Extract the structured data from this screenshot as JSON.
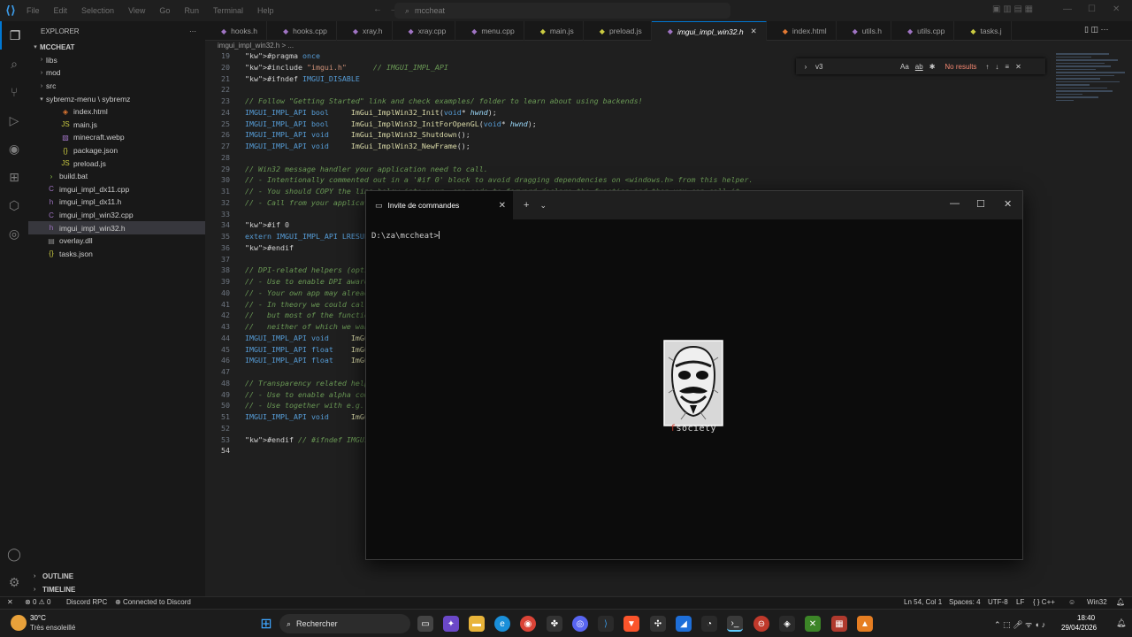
{
  "titlebar": {
    "menu": [
      "File",
      "Edit",
      "Selection",
      "View",
      "Go",
      "Run",
      "Terminal",
      "Help"
    ],
    "command_center": "mccheat"
  },
  "sidebar": {
    "explorer_title": "EXPLORER",
    "root": "MCCHEAT",
    "items": [
      {
        "label": "libs",
        "kind": "folder"
      },
      {
        "label": "mod",
        "kind": "folder"
      },
      {
        "label": "src",
        "kind": "folder"
      },
      {
        "label": "sybremz-menu \\ sybremz",
        "kind": "folder-open"
      },
      {
        "label": "index.html",
        "kind": "html"
      },
      {
        "label": "main.js",
        "kind": "js"
      },
      {
        "label": "minecraft.webp",
        "kind": "img"
      },
      {
        "label": "package.json",
        "kind": "json"
      },
      {
        "label": "preload.js",
        "kind": "js"
      },
      {
        "label": "build.bat",
        "kind": "bat"
      },
      {
        "label": "imgui_impl_dx11.cpp",
        "kind": "cpp"
      },
      {
        "label": "imgui_impl_dx11.h",
        "kind": "h"
      },
      {
        "label": "imgui_impl_win32.cpp",
        "kind": "cpp"
      },
      {
        "label": "imgui_impl_win32.h",
        "kind": "h"
      },
      {
        "label": "overlay.dll",
        "kind": "dll"
      },
      {
        "label": "tasks.json",
        "kind": "json"
      }
    ],
    "outline": "OUTLINE",
    "timeline": "TIMELINE"
  },
  "tabs": [
    {
      "label": "hooks.h"
    },
    {
      "label": "hooks.cpp"
    },
    {
      "label": "xray.h"
    },
    {
      "label": "xray.cpp"
    },
    {
      "label": "menu.cpp"
    },
    {
      "label": "main.js"
    },
    {
      "label": "preload.js"
    },
    {
      "label": "imgui_impl_win32.h"
    },
    {
      "label": "index.html"
    },
    {
      "label": "utils.h"
    },
    {
      "label": "utils.cpp"
    },
    {
      "label": "tasks.j"
    }
  ],
  "breadcrumb": "imgui_impl_win32.h > ...",
  "find": {
    "value": "v3",
    "result": "No results",
    "opt_case": "Aa",
    "opt_word": "ab"
  },
  "code": [
    {
      "n": "19",
      "t": "#pragma once"
    },
    {
      "n": "20",
      "t": "#include \"imgui.h\"      // IMGUI_IMPL_API"
    },
    {
      "n": "21",
      "t": "#ifndef IMGUI_DISABLE"
    },
    {
      "n": "22",
      "t": ""
    },
    {
      "n": "23",
      "t": "// Follow \"Getting Started\" link and check examples/ folder to learn about using backends!"
    },
    {
      "n": "24",
      "t": "IMGUI_IMPL_API bool     ImGui_ImplWin32_Init(void* hwnd);"
    },
    {
      "n": "25",
      "t": "IMGUI_IMPL_API bool     ImGui_ImplWin32_InitForOpenGL(void* hwnd);"
    },
    {
      "n": "26",
      "t": "IMGUI_IMPL_API void     ImGui_ImplWin32_Shutdown();"
    },
    {
      "n": "27",
      "t": "IMGUI_IMPL_API void     ImGui_ImplWin32_NewFrame();"
    },
    {
      "n": "28",
      "t": ""
    },
    {
      "n": "29",
      "t": "// Win32 message handler your application need to call."
    },
    {
      "n": "30",
      "t": "// - Intentionally commented out in a '#if 0' block to avoid dragging dependencies on <windows.h> from this helper."
    },
    {
      "n": "31",
      "t": "// - You should COPY the line below into your .cpp code to forward declare the function and then you can call it."
    },
    {
      "n": "32",
      "t": "// - Call from your application's message handler. Keep calling your message handler unless this function returns TRUE."
    },
    {
      "n": "33",
      "t": ""
    },
    {
      "n": "34",
      "t": "#if 0"
    },
    {
      "n": "35",
      "t": "extern IMGUI_IMPL_API LRESULT ImGui_ImplWin32_WndProcHandler(HWND hWnd, UINT msg, WPARAM wParam, LPARAM lParam);"
    },
    {
      "n": "36",
      "t": "#endif"
    },
    {
      "n": "37",
      "t": ""
    },
    {
      "n": "38",
      "t": "// DPI-related helpers (optional)"
    },
    {
      "n": "39",
      "t": "// - Use to enable DPI awareness without having to create an application manifest."
    },
    {
      "n": "40",
      "t": "// - Your own app may already do this via a manifest or explicit calls. This is mostly useful for our examples/ apps."
    },
    {
      "n": "41",
      "t": "// - In theory we could call simple functions from Windows SDK such as SetProcessDPIAware(), SetProcessDpiAwareness(), etc."
    },
    {
      "n": "42",
      "t": "//   but most of the functions provided by Microsoft require Windows 8.1/10+ SDK at compile time and Windows 8/10+ at runtime,"
    },
    {
      "n": "43",
      "t": "//   neither of which we want to require by default."
    },
    {
      "n": "44",
      "t": "IMGUI_IMPL_API void     ImGui_ImplWin32_EnableDpiAwareness();"
    },
    {
      "n": "45",
      "t": "IMGUI_IMPL_API float    ImGui_ImplWin32_GetDpiScaleForHwnd(void* hwnd);"
    },
    {
      "n": "46",
      "t": "IMGUI_IMPL_API float    ImGui_ImplWin32_GetDpiScaleForMonitor(void* monitor);"
    },
    {
      "n": "47",
      "t": ""
    },
    {
      "n": "48",
      "t": "// Transparency related helpers (optional) [experimental]"
    },
    {
      "n": "49",
      "t": "// - Use to enable alpha compositing transparency with the desktop."
    },
    {
      "n": "50",
      "t": "// - Use together with e.g. clearing your framebuffer with zero-alpha."
    },
    {
      "n": "51",
      "t": "IMGUI_IMPL_API void     ImGui_ImplWin32_EnableAlphaCompositing(void* hwnd);"
    },
    {
      "n": "52",
      "t": ""
    },
    {
      "n": "53",
      "t": "#endif // #ifndef IMGUI_DISABLE"
    },
    {
      "n": "54",
      "t": ""
    }
  ],
  "terminal": {
    "tab_title": "Invite de commandes",
    "prompt": "D:\\za\\mccheat>",
    "logo_text": "fsociety"
  },
  "statusbar": {
    "errors": "0",
    "warnings": "0",
    "discord_rpc": "Discord RPC",
    "discord_connected": "Connected to Discord",
    "position": "Ln 54, Col 1",
    "spaces": "Spaces: 4",
    "encoding": "UTF-8",
    "eol": "LF",
    "language": "C++",
    "platform": "Win32"
  },
  "taskbar": {
    "weather_temp": "30°C",
    "weather_desc": "Très ensoleillé",
    "search": "Rechercher",
    "time": "18:40",
    "date": "29/04/2026"
  },
  "colors": {
    "accent": "#0078d4",
    "error_text": "#f48771"
  }
}
